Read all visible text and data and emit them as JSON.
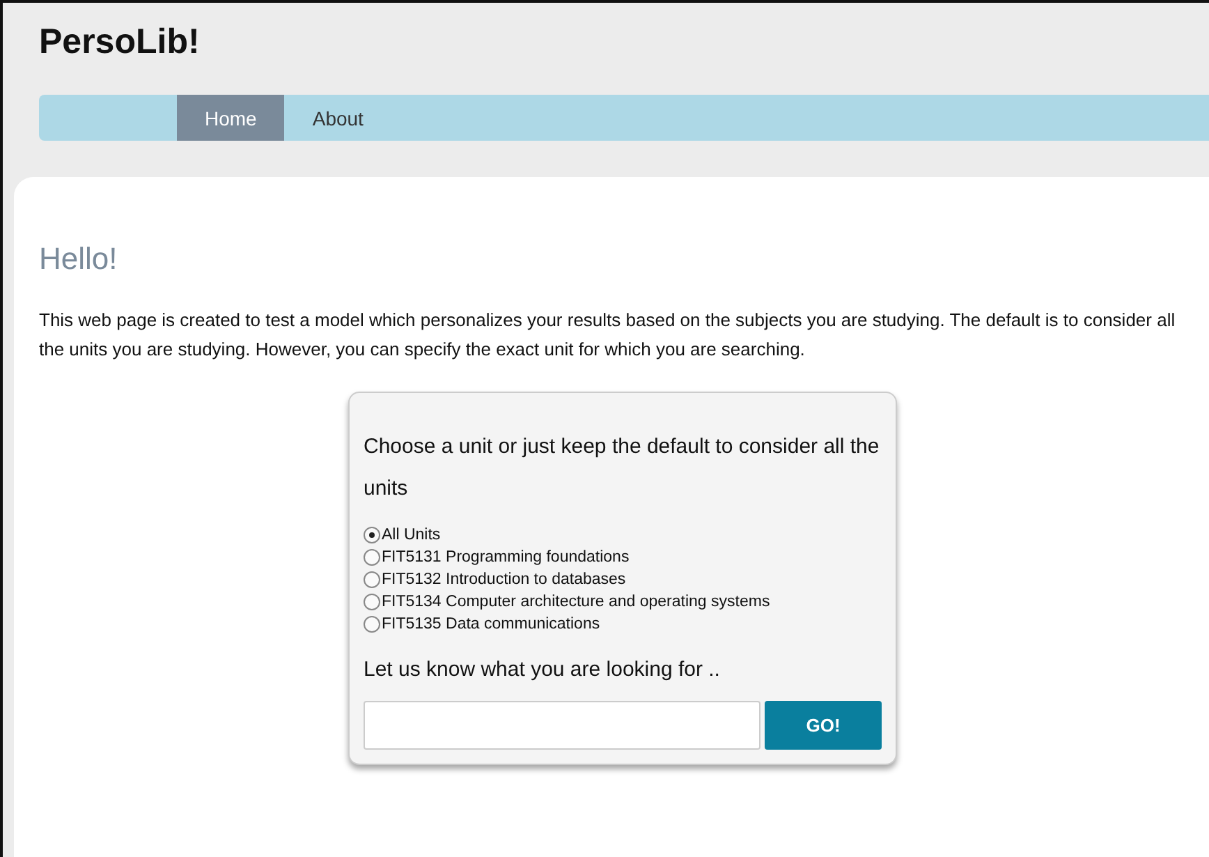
{
  "site_title": "PersoLib!",
  "nav": [
    {
      "label": "Home",
      "selected": true
    },
    {
      "label": "About",
      "selected": false
    }
  ],
  "heading": "Hello!",
  "intro": "This web page is created to test a model which personalizes your results based on the subjects you are studying. The default is to consider all the units you are studying. However, you can specify the exact unit for which you are searching.",
  "form": {
    "prompt": "Choose a unit or just keep the default to consider all the units",
    "units": [
      {
        "label": "All Units",
        "selected": true
      },
      {
        "label": "FIT5131 Programming foundations",
        "selected": false
      },
      {
        "label": "FIT5132 Introduction to databases",
        "selected": false
      },
      {
        "label": "FIT5134 Computer architecture and operating systems",
        "selected": false
      },
      {
        "label": "FIT5135 Data communications",
        "selected": false
      }
    ],
    "query_label": "Let us know what you are looking for ..",
    "button": "GO!"
  }
}
